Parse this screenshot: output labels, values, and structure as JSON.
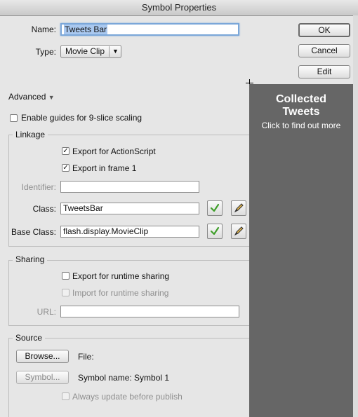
{
  "window": {
    "title": "Symbol Properties"
  },
  "form": {
    "name_label": "Name:",
    "name_value": "Tweets Bar",
    "type_label": "Type:",
    "type_value": "Movie Clip"
  },
  "buttons": {
    "ok": "OK",
    "cancel": "Cancel",
    "edit": "Edit"
  },
  "advanced": {
    "label": "Advanced",
    "nine_slice_label": "Enable guides for 9-slice scaling",
    "nine_slice_checked": false
  },
  "linkage": {
    "legend": "Linkage",
    "export_actionscript": "Export for ActionScript",
    "export_actionscript_checked": true,
    "export_frame1": "Export in frame 1",
    "export_frame1_checked": true,
    "identifier_label": "Identifier:",
    "identifier_value": "",
    "class_label": "Class:",
    "class_value": "TweetsBar",
    "base_class_label": "Base Class:",
    "base_class_value": "flash.display.MovieClip"
  },
  "sharing": {
    "legend": "Sharing",
    "export_runtime": "Export for runtime sharing",
    "export_runtime_checked": false,
    "import_runtime": "Import for runtime sharing",
    "import_runtime_checked": false,
    "url_label": "URL:",
    "url_value": ""
  },
  "source": {
    "legend": "Source",
    "browse_button": "Browse...",
    "file_label": "File:",
    "symbol_button": "Symbol...",
    "symbol_name": "Symbol name: Symbol 1",
    "always_update": "Always update before publish",
    "always_update_checked": false
  },
  "overlay": {
    "title": "Collected Tweets",
    "subtitle": "Click to find out more",
    "background": "#666666"
  },
  "colors": {
    "check_icon": "#3f9f2a",
    "focus_ring": "#7ba7d9"
  }
}
